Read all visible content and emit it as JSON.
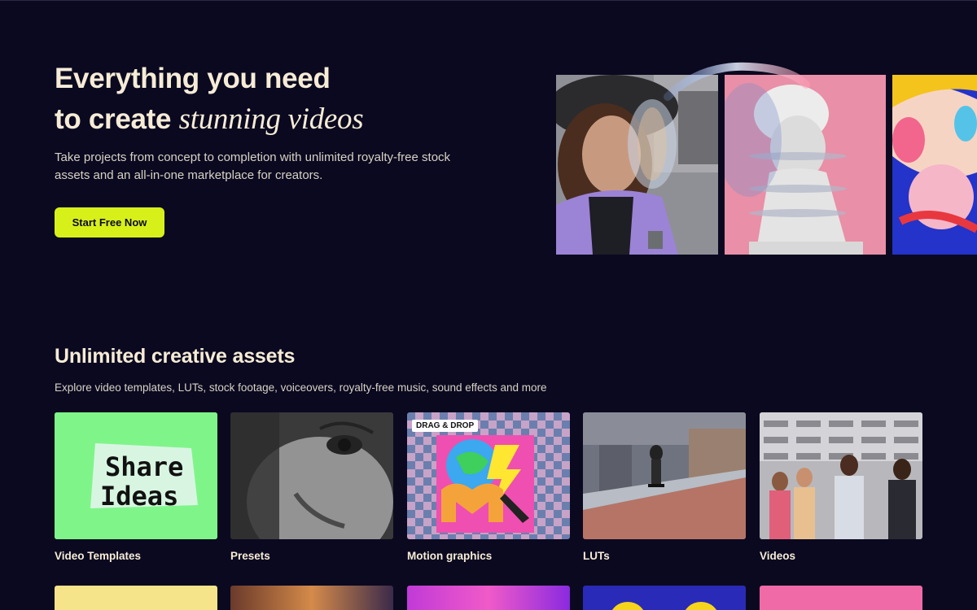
{
  "hero": {
    "title_line1": "Everything you need",
    "title_line2_prefix": "to create ",
    "title_line2_emphasis": "stunning videos",
    "description": "Take projects from concept to completion with unlimited royalty-free stock assets and an all-in-one marketplace for creators.",
    "cta_label": "Start Free Now"
  },
  "assets": {
    "title": "Unlimited creative assets",
    "subtitle": "Explore video templates, LUTs, stock footage, voiceovers, royalty-free music, sound effects and more",
    "cards": [
      {
        "label": "Video Templates",
        "thumb_text": "Share Ideas"
      },
      {
        "label": "Presets"
      },
      {
        "label": "Motion graphics",
        "badge": "DRAG & DROP"
      },
      {
        "label": "LUTs"
      },
      {
        "label": "Videos"
      }
    ]
  },
  "colors": {
    "background": "#0b0920",
    "accent": "#d7f01a",
    "text": "#f6ecd6"
  }
}
